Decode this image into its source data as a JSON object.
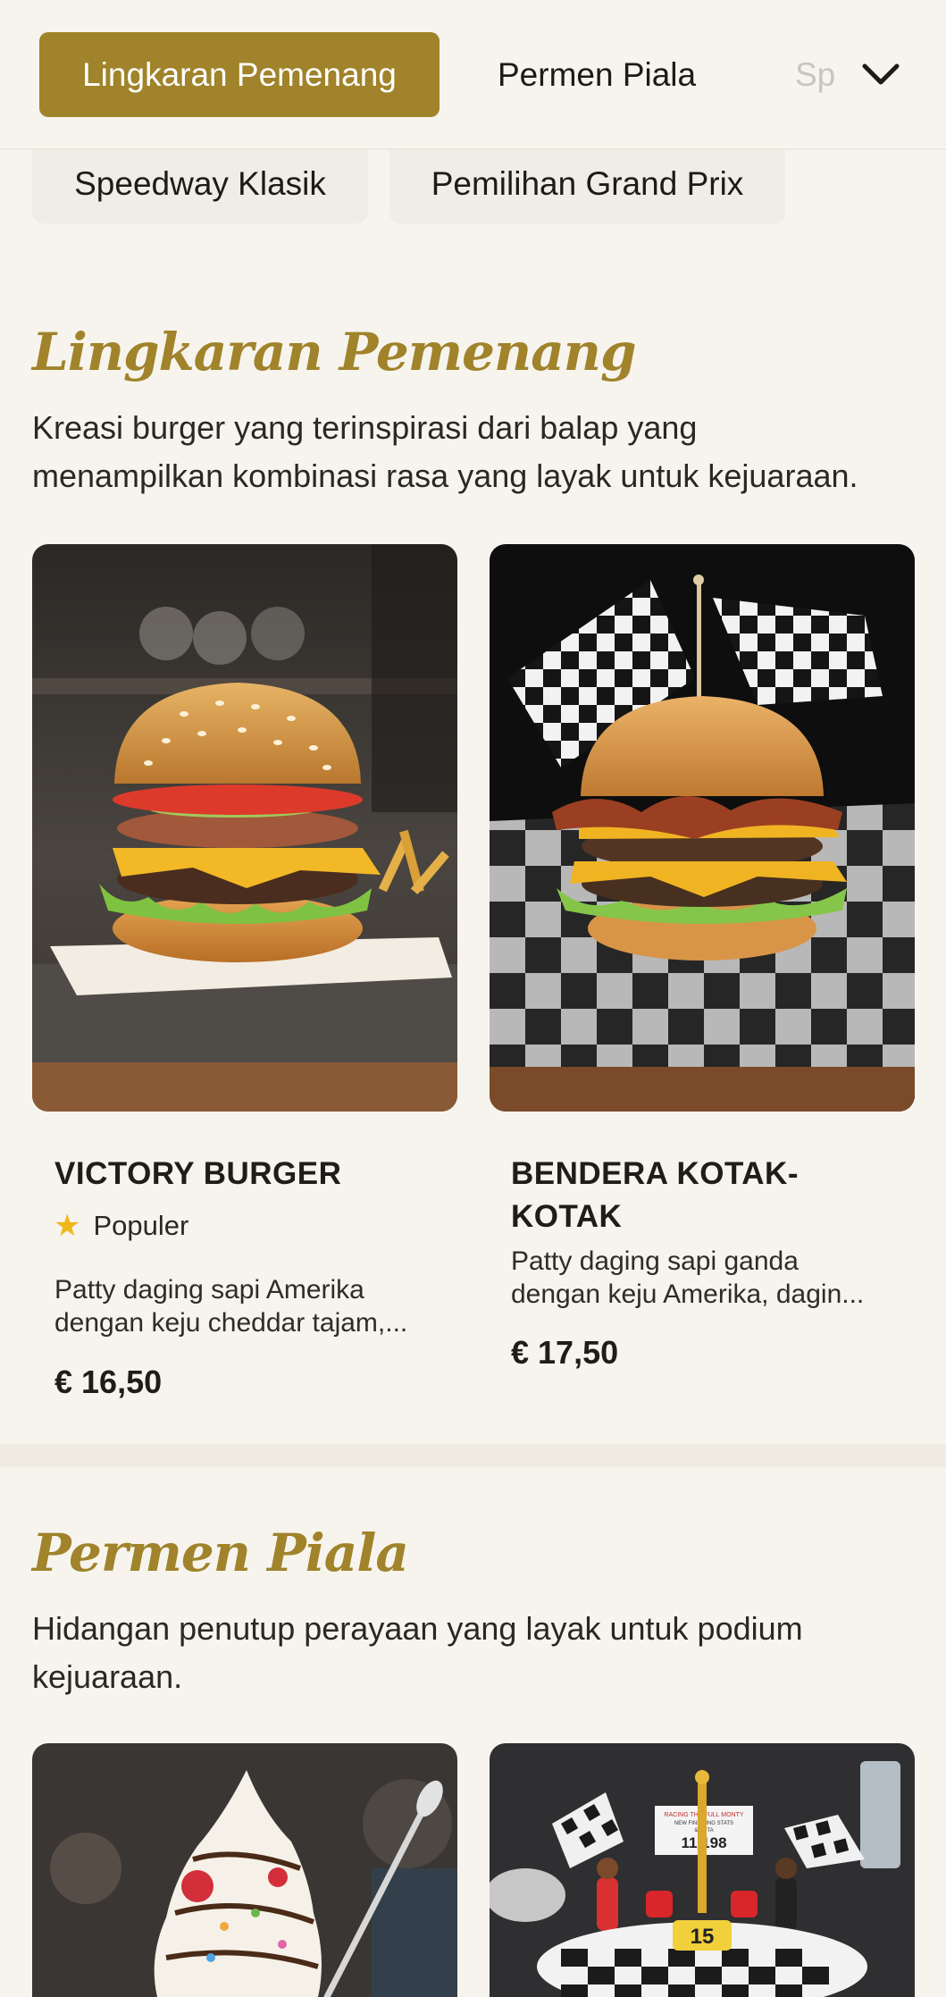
{
  "category_nav": {
    "tabs": [
      {
        "label": "Lingkaran Pemenang",
        "active": true
      },
      {
        "label": "Permen Piala",
        "active": false
      },
      {
        "label": "Sp",
        "active": false
      }
    ],
    "subtabs": [
      {
        "label": "Speedway Klasik"
      },
      {
        "label": "Pemilihan Grand Prix"
      }
    ],
    "chevron_icon": "chevron-down-icon"
  },
  "sections": [
    {
      "title": "Lingkaran Pemenang",
      "description_lines": [
        "Kreasi burger yang terinspirasi dari balap yang",
        "menampilkan kombinasi rasa yang layak untuk kejuaraan."
      ],
      "items": [
        {
          "name_lines": [
            "VICTORY BURGER"
          ],
          "badge": "Populer",
          "badge_icon": "star-icon",
          "description_lines": [
            "Patty daging sapi Amerika",
            "dengan keju cheddar tajam,..."
          ],
          "price": "€ 16,50"
        },
        {
          "name_lines": [
            "BENDERA KOTAK-",
            "KOTAK"
          ],
          "description_lines": [
            "Patty daging sapi ganda",
            "dengan keju Amerika, dagin..."
          ],
          "price": "€ 17,50"
        }
      ]
    },
    {
      "title": "Permen Piala",
      "description_lines": [
        "Hidangan penutup perayaan yang layak untuk podium",
        "kejuaraan."
      ],
      "items": [
        {
          "image": "sundae"
        },
        {
          "image": "cake",
          "cake_sign_lines": [
            "RACING THE FULL MONTY",
            "NEW FINISHING STATS",
            "& FOTA",
            "11/198"
          ],
          "cake_number": "15"
        }
      ]
    }
  ],
  "colors": {
    "accent": "#a0832a",
    "background": "#f7f4ee",
    "star": "#f1b719"
  }
}
